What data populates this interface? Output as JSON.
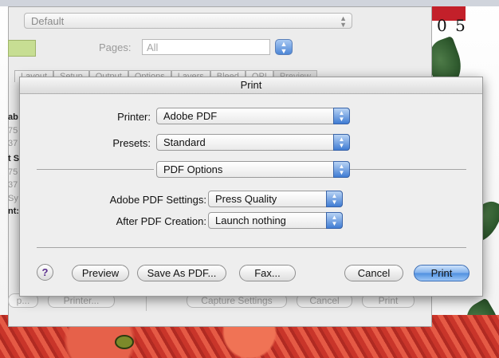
{
  "background": {
    "art_number": "0 5",
    "colors": {
      "banner": "#c3202a",
      "leaf": "#2f5a2e",
      "berry": "#c9352a"
    }
  },
  "under_window": {
    "top_select": "Default",
    "pages_label": "Pages:",
    "pages_value": "All",
    "tabs": [
      "Layout",
      "Setup",
      "Output",
      "Options",
      "Layers",
      "Bleed",
      "OPI",
      "Preview"
    ],
    "side_fragments": [
      "ab",
      "75",
      "37",
      "t S",
      "75",
      "37",
      "Sy",
      "nt:"
    ],
    "bottom_buttons": [
      "p...",
      "Printer...",
      "Capture Settings",
      "Cancel",
      "Print"
    ]
  },
  "print_sheet": {
    "title": "Print",
    "printer_label": "Printer:",
    "printer_value": "Adobe PDF",
    "presets_label": "Presets:",
    "presets_value": "Standard",
    "panel_value": "PDF Options",
    "pdf_settings_label": "Adobe PDF Settings:",
    "pdf_settings_value": "Press Quality",
    "after_creation_label": "After PDF Creation:",
    "after_creation_value": "Launch nothing",
    "help_label": "?",
    "buttons": {
      "preview": "Preview",
      "save_as_pdf": "Save As PDF...",
      "fax": "Fax...",
      "cancel": "Cancel",
      "print": "Print"
    },
    "accent_color": "#4e8fe0"
  }
}
